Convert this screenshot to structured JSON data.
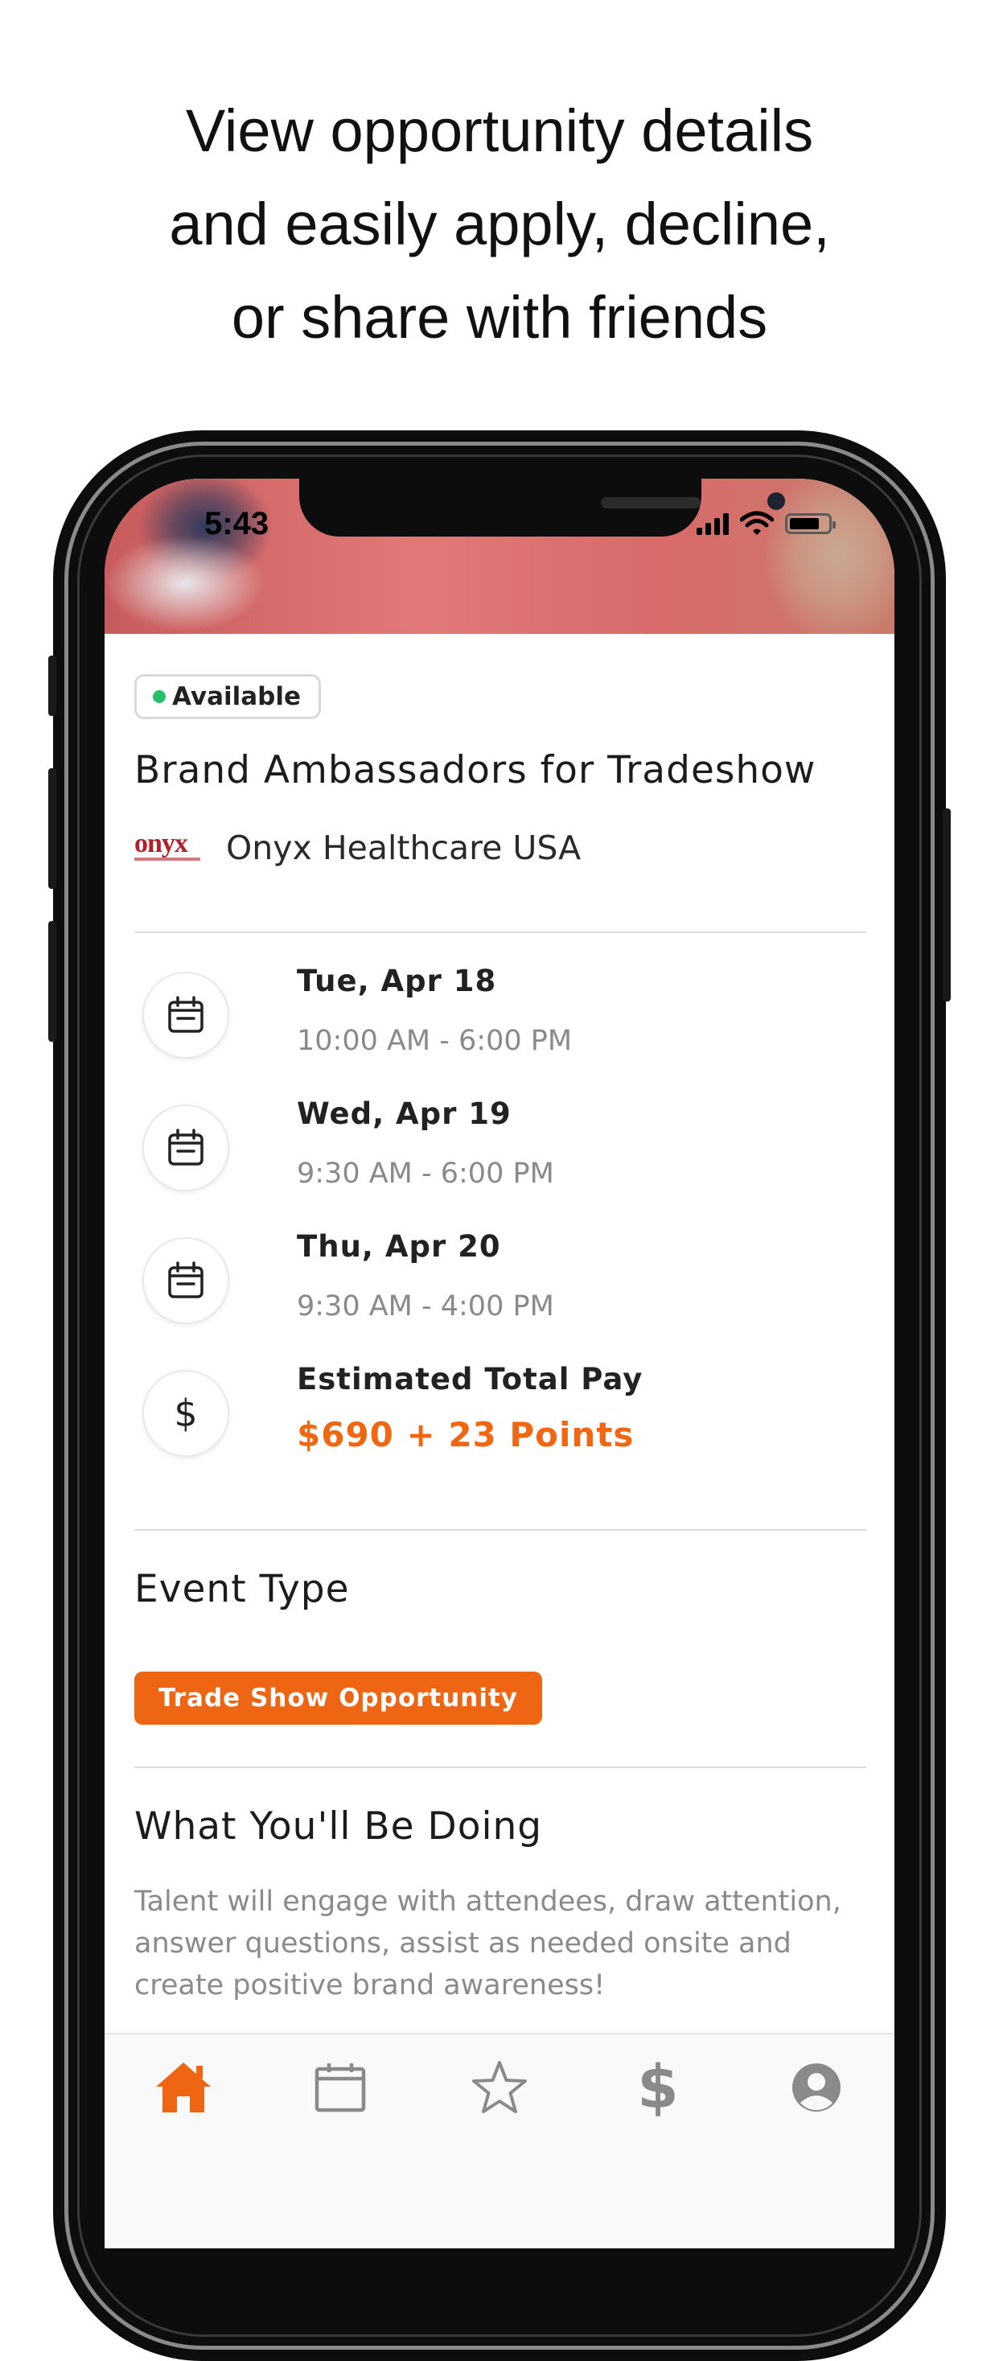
{
  "headline": {
    "lines": [
      "View opportunity details",
      "and easily apply, decline,",
      "or share with friends"
    ]
  },
  "status_bar": {
    "time": "5:43"
  },
  "opportunity": {
    "status": "Available",
    "title": "Brand Ambassadors for Tradeshow",
    "company": {
      "logo_text": "onyx",
      "name": "Onyx Healthcare USA"
    },
    "schedule": [
      {
        "day": "Tue, Apr 18",
        "hours": "10:00 AM - 6:00 PM",
        "icon": "calendar-icon"
      },
      {
        "day": "Wed, Apr 19",
        "hours": "9:30 AM - 6:00 PM",
        "icon": "calendar-icon"
      },
      {
        "day": "Thu, Apr 20",
        "hours": "9:30 AM - 4:00 PM",
        "icon": "calendar-icon"
      }
    ],
    "pay": {
      "label": "Estimated Total Pay",
      "value": "$690 + 23 Points",
      "icon": "dollar-icon"
    }
  },
  "event_type": {
    "heading": "Event Type",
    "tag": "Trade Show Opportunity"
  },
  "doing": {
    "heading": "What You'll Be Doing",
    "description": "Talent will engage with attendees, draw attention, answer questions, assist as needed onsite and create positive brand awareness!"
  },
  "tab_bar": {
    "items": [
      {
        "icon": "home-icon",
        "active": true
      },
      {
        "icon": "calendar-icon",
        "active": false
      },
      {
        "icon": "star-icon",
        "active": false
      },
      {
        "icon": "dollar-icon",
        "active": false
      },
      {
        "icon": "profile-icon",
        "active": false
      }
    ]
  },
  "colors": {
    "accent": "#EE6514",
    "available": "#27C06A",
    "muted": "#8A8A8A",
    "hero": "#D86A6A"
  }
}
